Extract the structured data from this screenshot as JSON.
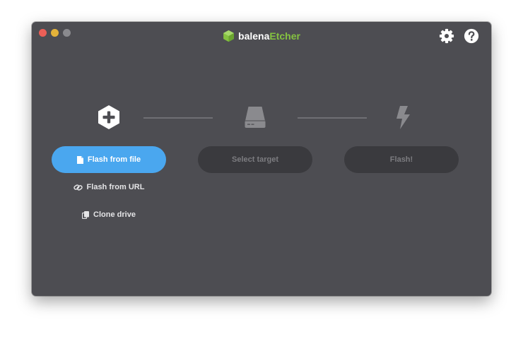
{
  "window": {
    "controls": [
      "close",
      "minimize",
      "maximize"
    ]
  },
  "header": {
    "brand_part1": "balena",
    "brand_part2": "Etcher",
    "icons": [
      "gear-icon",
      "help-icon"
    ]
  },
  "steps": {
    "source_icon": "plus-hexagon-icon",
    "target_icon": "drive-icon",
    "flash_icon": "lightning-icon"
  },
  "actions": {
    "flash_from_file": "Flash from file",
    "flash_from_url": "Flash from URL",
    "clone_drive": "Clone drive",
    "select_target": "Select target",
    "flash": "Flash!"
  },
  "colors": {
    "window_bg": "#4d4d52",
    "primary": "#4aa7ef",
    "brand_green": "#85c240",
    "disabled_bg": "#3a3a3e",
    "disabled_text": "#7c7c80"
  }
}
